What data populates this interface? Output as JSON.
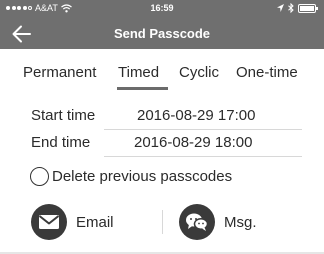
{
  "status_bar": {
    "carrier": "A&AT",
    "time": "16:59"
  },
  "nav": {
    "title": "Send Passcode",
    "back_icon": "arrow-left-icon"
  },
  "tabs": [
    {
      "label": "Permanent",
      "selected": false
    },
    {
      "label": "Timed",
      "selected": true
    },
    {
      "label": "Cyclic",
      "selected": false
    },
    {
      "label": "One-time",
      "selected": false
    }
  ],
  "form": {
    "start_time_label": "Start time",
    "start_time_value": "2016-08-29 17:00",
    "end_time_label": "End time",
    "end_time_value": "2016-08-29 18:00"
  },
  "delete_option": {
    "label": "Delete previous passcodes",
    "checked": false
  },
  "actions": {
    "email_label": "Email",
    "email_icon": "envelope-icon",
    "msg_label": "Msg.",
    "msg_icon": "chat-bubbles-icon"
  },
  "colors": {
    "header_bg": "#6f6f6f",
    "icon_bg": "#3a3a3a"
  }
}
